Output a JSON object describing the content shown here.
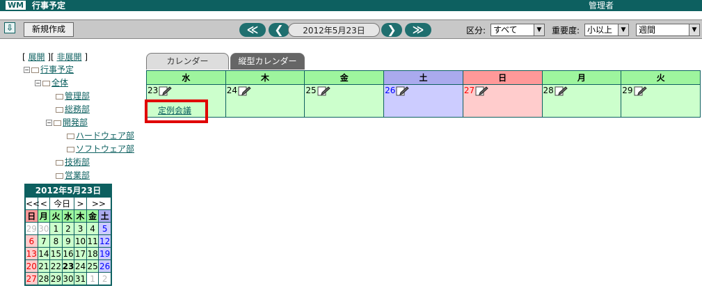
{
  "header": {
    "logo": "WM",
    "title": "行事予定",
    "user": "管理者"
  },
  "toolbar": {
    "new_button": "新規作成",
    "nav_prev_far": "≪",
    "nav_prev": "❮",
    "current_date": "2012年5月23日",
    "nav_next": "❯",
    "nav_next_far": "≫",
    "category_label": "区分:",
    "category_value": "すべて",
    "importance_label": "重要度:",
    "importance_value": "小以上",
    "view_value": "週間"
  },
  "tree": {
    "controls": {
      "open": "展開",
      "close": "非展開"
    },
    "root": "行事予定",
    "all": "全体",
    "depts": [
      "管理部",
      "総務部",
      "開発部",
      "ハードウェア部",
      "ソフトウェア部",
      "技術部",
      "営業部"
    ]
  },
  "mini_calendar": {
    "title": "2012年5月23日",
    "nav": [
      "<<",
      "<",
      "今日",
      ">",
      ">>"
    ],
    "weekdays": [
      "日",
      "月",
      "火",
      "水",
      "木",
      "金",
      "土"
    ],
    "weeks": [
      [
        "29",
        "30",
        "1",
        "2",
        "3",
        "4",
        "5"
      ],
      [
        "6",
        "7",
        "8",
        "9",
        "10",
        "11",
        "12"
      ],
      [
        "13",
        "14",
        "15",
        "16",
        "17",
        "18",
        "19"
      ],
      [
        "20",
        "21",
        "22",
        "23",
        "24",
        "25",
        "26"
      ],
      [
        "27",
        "28",
        "29",
        "30",
        "31",
        "1",
        "2"
      ]
    ]
  },
  "tabs": {
    "calendar": "カレンダー",
    "vertical": "縦型カレンダー"
  },
  "week": {
    "headers": [
      "水",
      "木",
      "金",
      "土",
      "日",
      "月",
      "火"
    ],
    "days": [
      "23",
      "24",
      "25",
      "26",
      "27",
      "28",
      "29"
    ],
    "event_title": "定例会議"
  },
  "colors": {
    "brand": "#0d6060",
    "weekday_header": "#9ef59e",
    "weekday_cell": "#ccffcc",
    "saturday": "#aaaaee",
    "saturday_cell": "#ccccff",
    "sunday": "#ff9999",
    "sunday_cell": "#ffcccc",
    "highlight": "#e00000"
  }
}
